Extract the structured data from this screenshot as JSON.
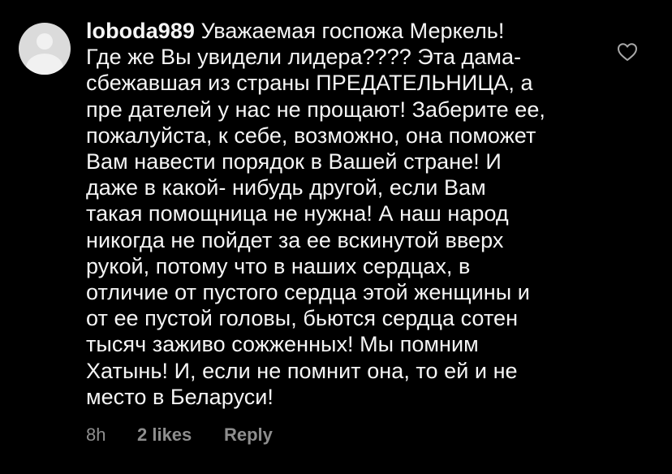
{
  "comment": {
    "username": "loboda989",
    "text": "Уважаемая госпожа Меркель!\nГде же Вы увидели лидера???? Эта дама-\nсбежавшая из страны ПРЕДАТЕЛЬНИЦА, а\nпре дателей у нас не прощают! Заберите ее,\nпожалуйста, к себе, возможно, она поможет\nВам навести порядок в Вашей стране! И\nдаже  в какой- нибудь другой, если Вам\nтакая помощница не нужна!  А наш народ\nникогда не пойдет за ее вскинутой вверх\nрукой, потому что в наших сердцах, в\nотличие от пустого сердца этой женщины и\nот ее пустой головы, бьются сердца сотен\nтысяч заживо сожженных! Мы помним\nХатынь! И, если не помнит она, то ей и не\nместо в Беларуси!",
    "time": "8h",
    "likes": "2 likes",
    "reply_label": "Reply",
    "avatar_icon": "default-avatar-icon",
    "like_icon": "heart-outline-icon"
  },
  "colors": {
    "background": "#000000",
    "text": "#f5f5f5",
    "meta": "#8e8e8e",
    "avatar": "#dbdbdb"
  }
}
